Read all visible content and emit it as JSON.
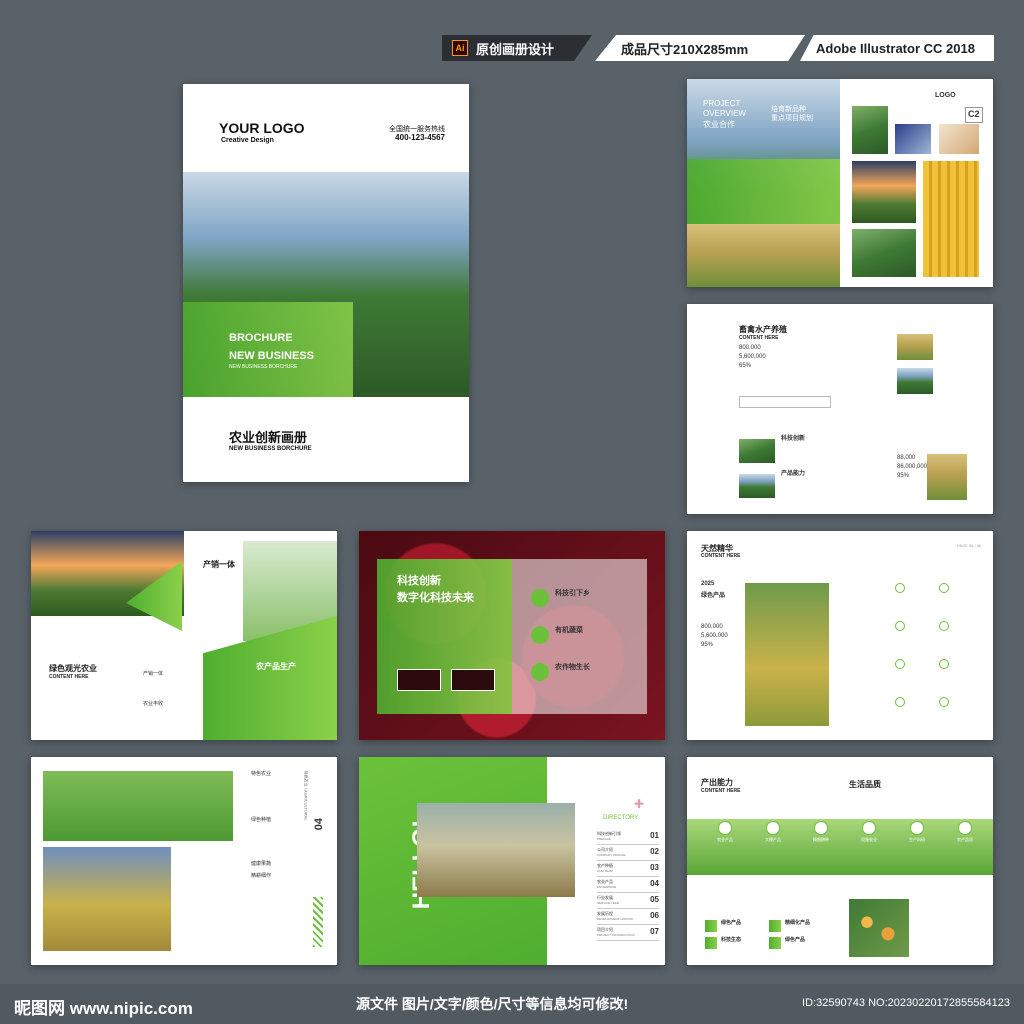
{
  "header": {
    "ai_icon": "Ai",
    "badge1": "原创画册设计",
    "badge2": "成品尺寸210X285mm",
    "badge3": "Adobe Illustrator CC 2018"
  },
  "cover": {
    "logo": "YOUR LOGO",
    "logo_sub": "Creative Design",
    "hotline": "全国统一服务热线",
    "phone": "400-123-4567",
    "title_line1": "BROCHURE",
    "title_line2": "NEW BUSINESS",
    "title_sub": "NEW BUSINESS BORCHURE",
    "cn_title": "农业创新画册",
    "cn_sub": "NEW BUSINESS BORCHURE"
  },
  "spread_overview": {
    "title_line1": "PROJECT",
    "title_line2": "OVERVIEW",
    "cn_label": "农业合作",
    "cn_text1": "培育新品种",
    "cn_text2": "重点项目规划",
    "logo": "LOGO",
    "page_code": "C2"
  },
  "spread_livestock": {
    "title": "畜禽水产养殖",
    "sub": "CONTENT HERE",
    "num1": "800,000",
    "num2": "5,600,000",
    "num3": "65%",
    "num4": "88,000",
    "num5": "86,000,000",
    "num6": "95%",
    "label1": "科技创新",
    "label2": "产品能力"
  },
  "spread_green": {
    "title": "绿色观光农业",
    "sub": "CONTENT HERE",
    "integration": "产销一体",
    "icon_label1": "产销一体",
    "icon_label2": "农业丰收",
    "production": "农产品生产"
  },
  "spread_tech": {
    "title_line1": "科技创新",
    "title_line2": "数字化科技未来",
    "item1": "科技引下乡",
    "item2": "有机蔬菜",
    "item3": "农作物生长"
  },
  "spread_nature": {
    "title": "天然精华",
    "sub": "CONTENT HERE",
    "year": "2025",
    "label": "绿色产品",
    "num1": "800,000",
    "num2": "5,600,000",
    "num3": "95%",
    "page": "PAGE 05 / 06"
  },
  "spread_04": {
    "cat1": "特色农业",
    "cat2": "绿色种植",
    "cat3": "健康果蔬",
    "cat4": "精耕细作",
    "num": "04",
    "side_text": "特色农业 / AGRICULTURAL"
  },
  "spread_directory": {
    "hello": "HELLO!",
    "directory": "DIRECTORY",
    "items": [
      {
        "cn": "科技创新引领",
        "en": "PREFACE",
        "num": "01"
      },
      {
        "cn": "公司介绍",
        "en": "COMPANY PROFILE",
        "num": "02"
      },
      {
        "cn": "农产种植",
        "en": "OUR TEAM",
        "num": "03"
      },
      {
        "cn": "农业产品",
        "en": "ENTERPRISE",
        "num": "04"
      },
      {
        "cn": "行业发展",
        "en": "SERVICE TEAM",
        "num": "05"
      },
      {
        "cn": "发展历程",
        "en": "DEVELOPMENT HISTORY",
        "num": "06"
      },
      {
        "cn": "项目介绍",
        "en": "PROJECT INTRODUCTION",
        "num": "07"
      }
    ]
  },
  "spread_capacity": {
    "title": "产出能力",
    "sub": "CONTENT HERE",
    "right_title": "生活品质",
    "icons": [
      "农业产品",
      "大棚产品",
      "精细耕种",
      "设施农业",
      "生产科研",
      "农产品质"
    ],
    "box1": "绿色产品",
    "box2": "精细化产品",
    "box3": "科技生态",
    "box4": "绿色产品"
  },
  "footer": {
    "site": "昵图网 www.nipic.com",
    "note": "源文件 图片/文字/颜色/尺寸等信息均可修改!",
    "id": "ID:32590743 NO:20230220172855584123"
  }
}
